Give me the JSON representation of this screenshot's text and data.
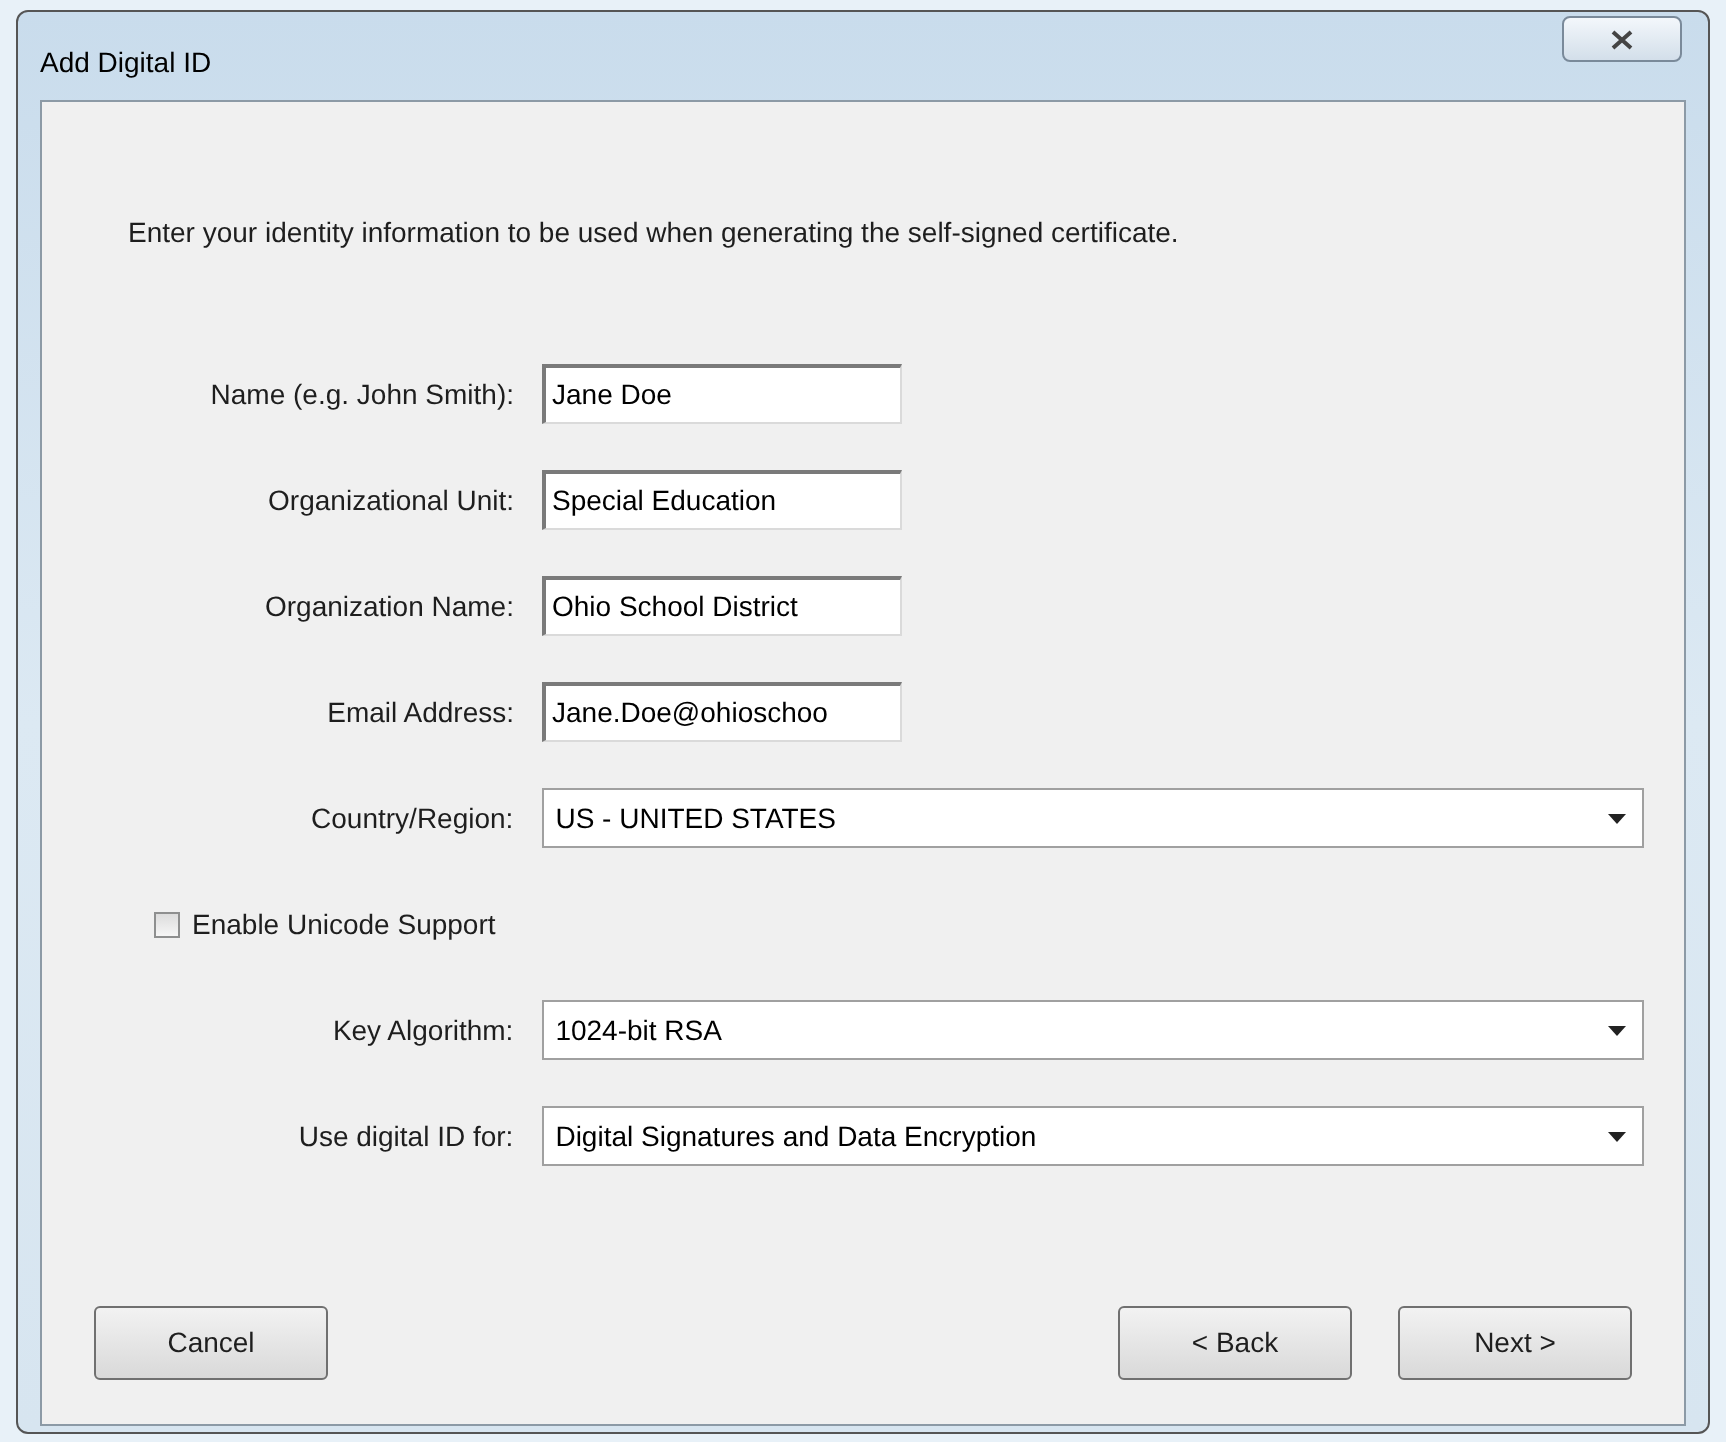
{
  "window": {
    "title": "Add Digital ID"
  },
  "instruction": "Enter your identity information to be used when generating the self-signed certificate.",
  "fields": [
    {
      "kind": "text",
      "label": "Name (e.g. John Smith):",
      "value": "Jane Doe"
    },
    {
      "kind": "text",
      "label": "Organizational Unit:",
      "value": "Special Education"
    },
    {
      "kind": "text",
      "label": "Organization Name:",
      "value": "Ohio School District"
    },
    {
      "kind": "text",
      "label": "Email Address:",
      "value": "Jane.Doe@ohioschoo"
    },
    {
      "kind": "select",
      "label": "Country/Region:",
      "value": "US - UNITED STATES"
    },
    {
      "kind": "checkbox",
      "label": "Enable Unicode Support",
      "checked": false
    },
    {
      "kind": "select",
      "label": "Key Algorithm:",
      "value": "1024-bit RSA"
    },
    {
      "kind": "select",
      "label": "Use digital ID for:",
      "value": "Digital Signatures and Data Encryption"
    }
  ],
  "buttons": {
    "cancel": "Cancel",
    "back": "< Back",
    "next": "Next >"
  }
}
